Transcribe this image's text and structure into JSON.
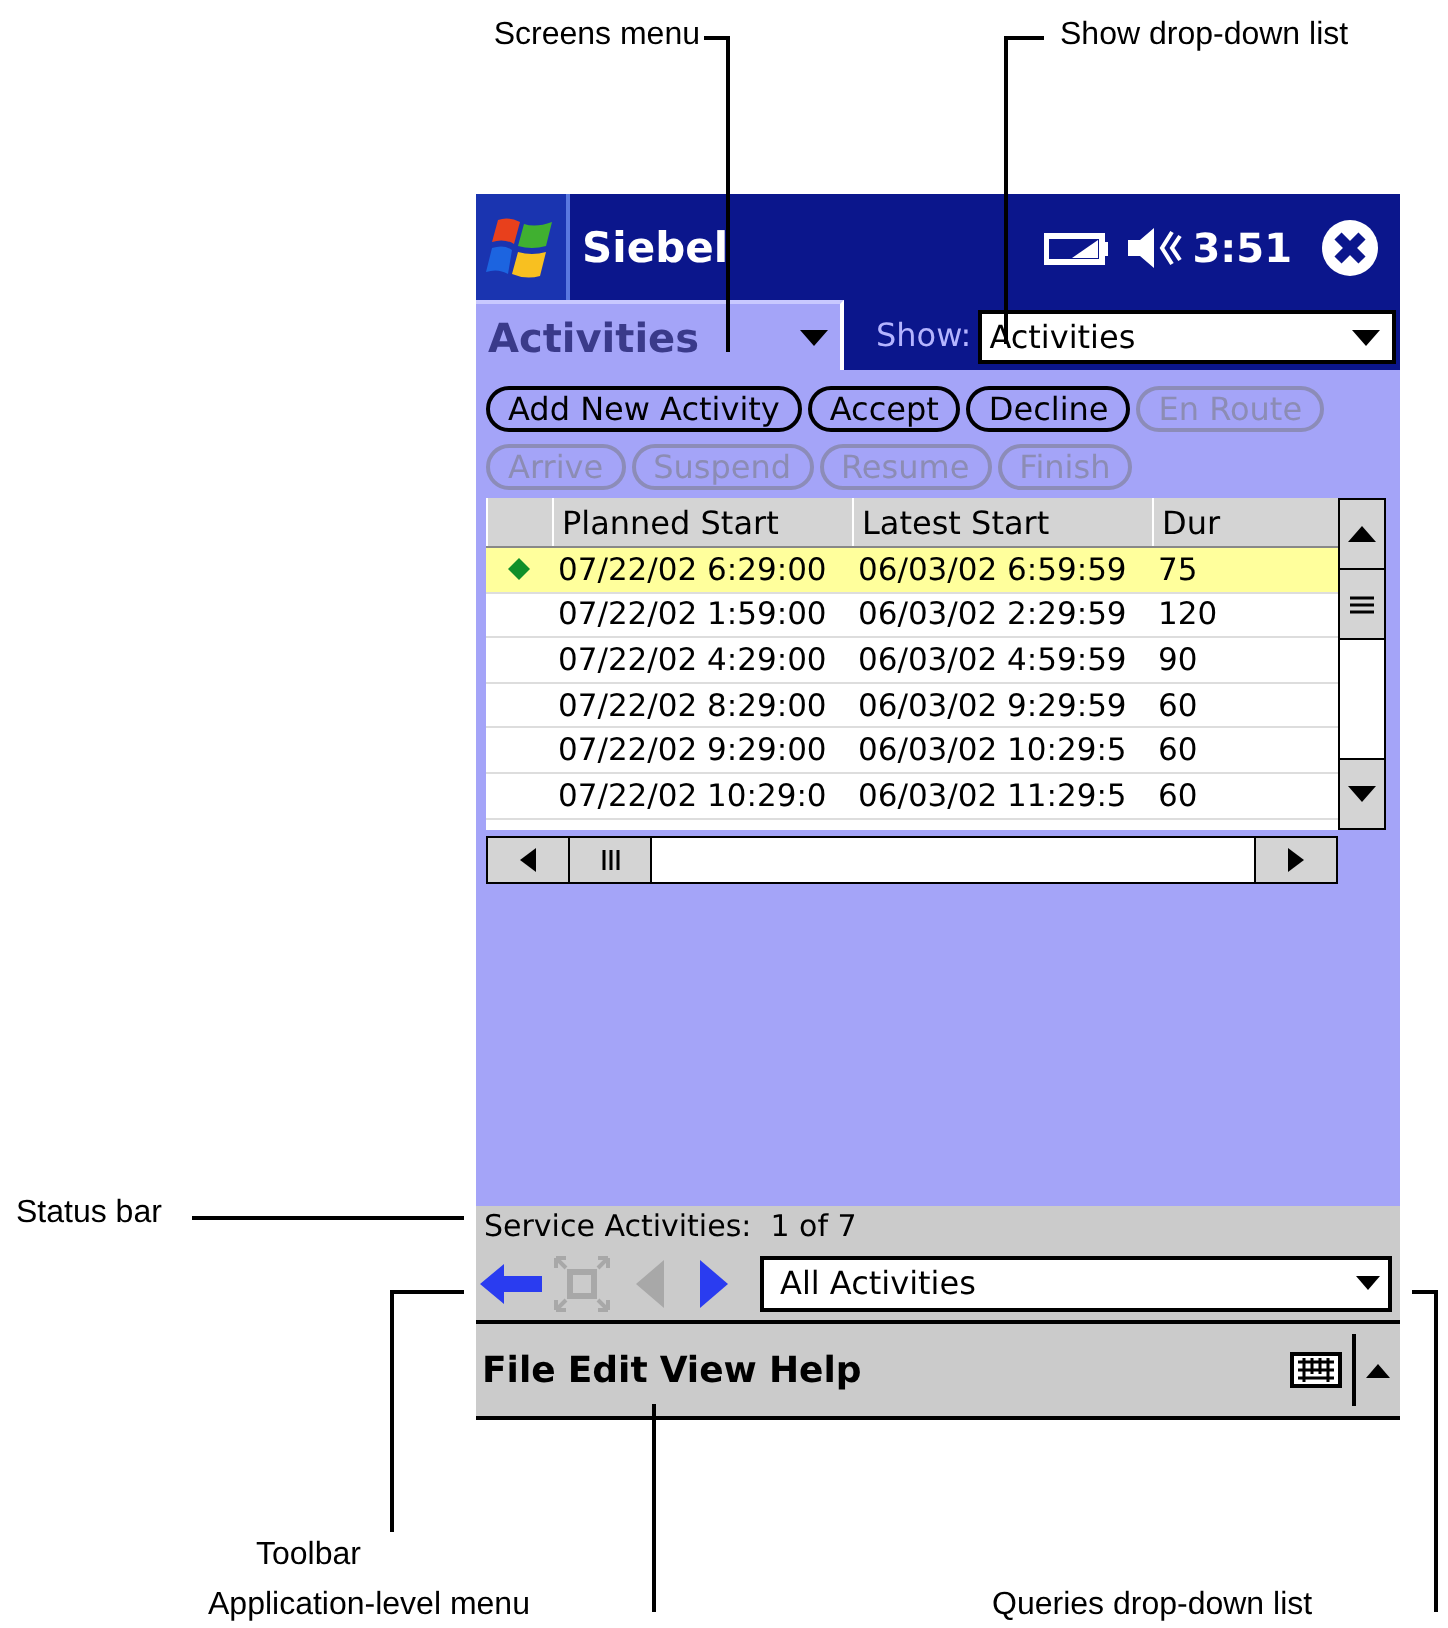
{
  "callouts": [
    {
      "label": "Screens menu"
    },
    {
      "label": "Show drop-down list"
    },
    {
      "label": "Status bar"
    },
    {
      "label": "Toolbar"
    },
    {
      "label": "Application-level menu"
    },
    {
      "label": "Queries drop-down list"
    }
  ],
  "title_bar": {
    "app": "Siebel",
    "time": "3:51"
  },
  "screens_menu": {
    "label": "Activities"
  },
  "show": {
    "label": "Show:",
    "value": "Activities"
  },
  "button_rows": [
    [
      {
        "label": "Add New Activity",
        "disabled": false
      },
      {
        "label": "Accept",
        "disabled": false
      },
      {
        "label": "Decline",
        "disabled": false
      },
      {
        "label": "En Route",
        "disabled": true
      }
    ],
    [
      {
        "label": "Arrive",
        "disabled": true
      },
      {
        "label": "Suspend",
        "disabled": true
      },
      {
        "label": "Resume",
        "disabled": true
      },
      {
        "label": "Finish",
        "disabled": true
      }
    ]
  ],
  "table": {
    "columns": [
      "Planned Start",
      "Latest Start",
      "Dur"
    ],
    "rows": [
      {
        "selected": true,
        "cells": [
          "07/22/02 6:29:00",
          "06/03/02 6:59:59",
          "75"
        ]
      },
      {
        "selected": false,
        "cells": [
          "07/22/02 1:59:00",
          "06/03/02 2:29:59",
          "120"
        ]
      },
      {
        "selected": false,
        "cells": [
          "07/22/02 4:29:00",
          "06/03/02 4:59:59",
          "90"
        ]
      },
      {
        "selected": false,
        "cells": [
          "07/22/02 8:29:00",
          "06/03/02 9:29:59",
          "60"
        ]
      },
      {
        "selected": false,
        "cells": [
          "07/22/02 9:29:00",
          "06/03/02 10:29:5",
          "60"
        ]
      },
      {
        "selected": false,
        "cells": [
          "07/22/02 10:29:0",
          "06/03/02 11:29:5",
          "60"
        ]
      }
    ]
  },
  "status_bar": "Service Activities:  1 of 7",
  "toolbar": {
    "buttons": [
      {
        "kind": "back",
        "disabled": false
      },
      {
        "kind": "expand",
        "disabled": true
      },
      {
        "kind": "previous",
        "disabled": true
      },
      {
        "kind": "next",
        "disabled": false
      }
    ],
    "query": "All Activities"
  },
  "menu": [
    "File",
    "Edit",
    "View",
    "Help"
  ]
}
